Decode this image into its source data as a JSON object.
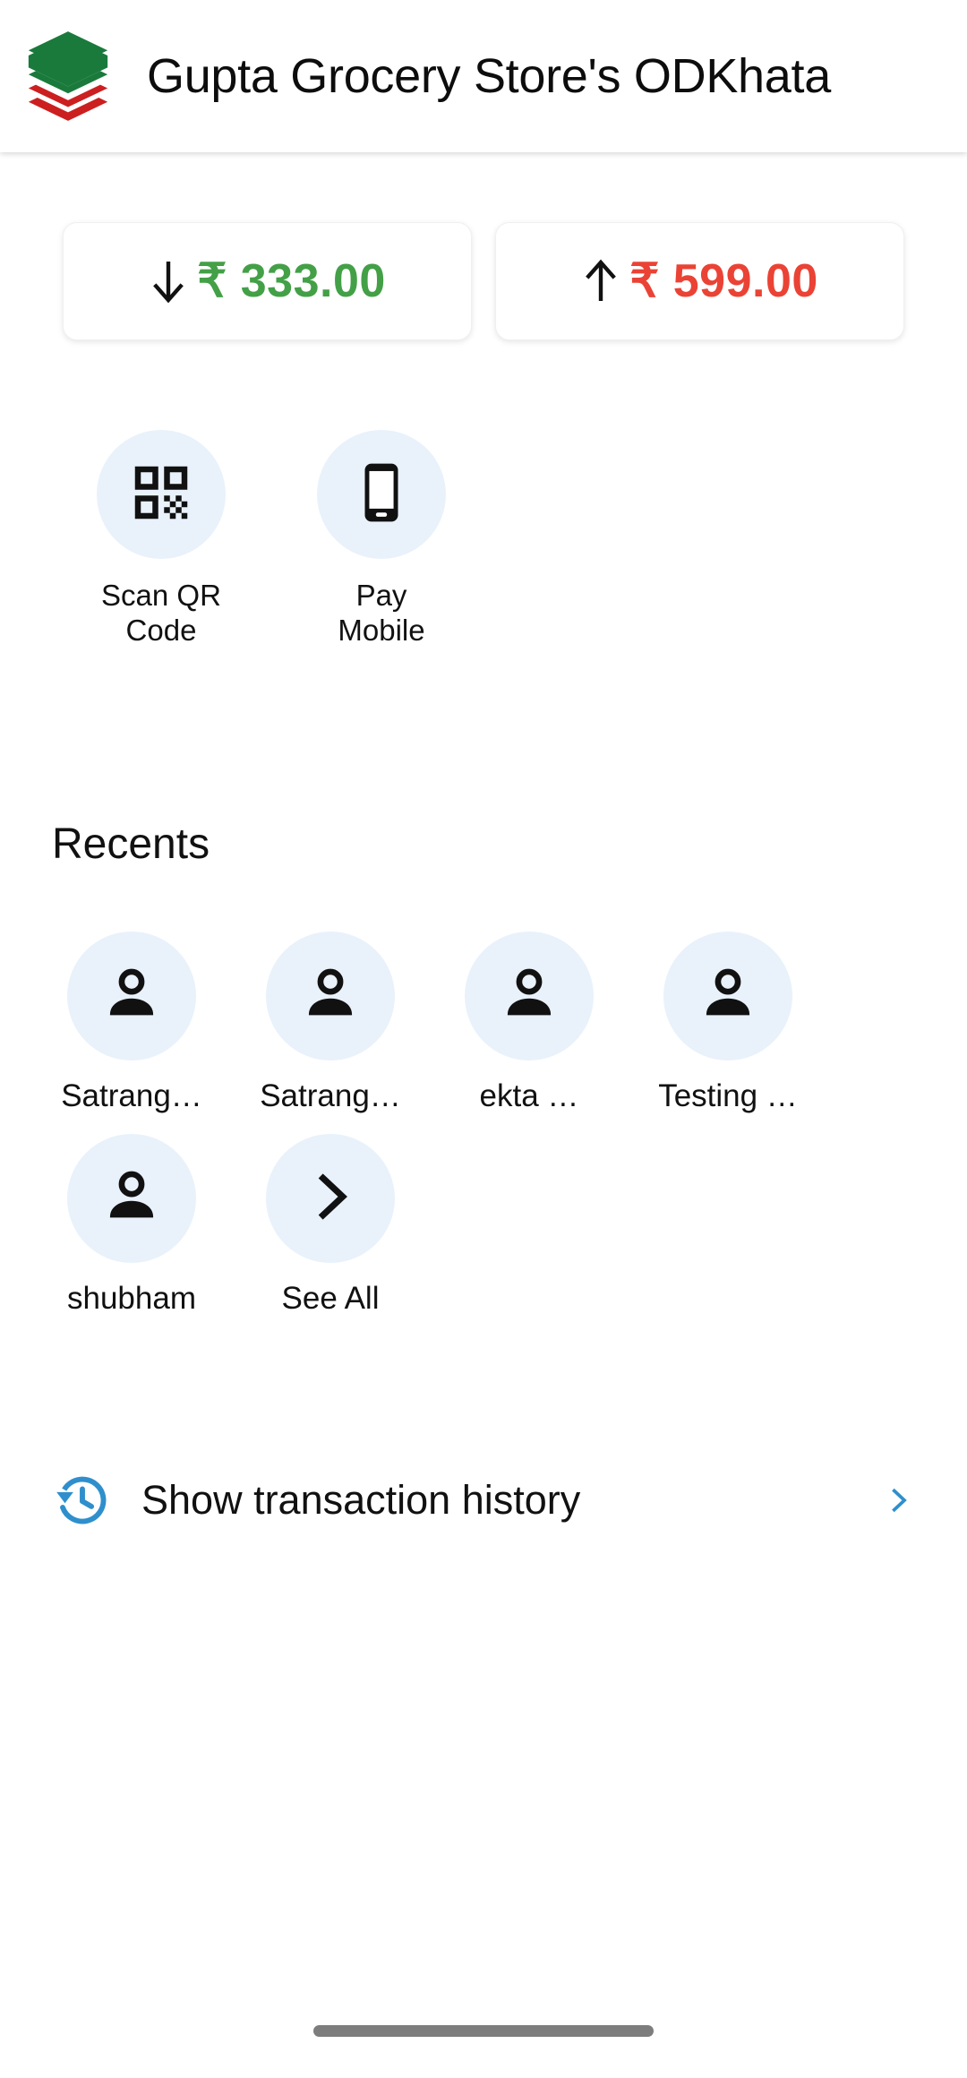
{
  "header": {
    "title": "Gupta Grocery Store's ODKhata",
    "logo_name": "odkhata-stacked-books-logo",
    "logo_colors": {
      "top": "#1a7a3c",
      "bottom": "#cc1f1f",
      "gap": "#ffffff"
    }
  },
  "balance": {
    "cards": [
      {
        "direction": "down",
        "arrow_icon": "arrow-down-icon",
        "currency": "₹",
        "amount": "333.00",
        "display": "₹ 333.00",
        "color": "#43a047"
      },
      {
        "direction": "up",
        "arrow_icon": "arrow-up-icon",
        "currency": "₹",
        "amount": "599.00",
        "display": "₹ 599.00",
        "color": "#ea4335"
      }
    ]
  },
  "quick_actions": [
    {
      "id": "scan-qr-code",
      "icon": "qr-code-icon",
      "line1": "Scan QR",
      "line2": "Code"
    },
    {
      "id": "pay-mobile",
      "icon": "smartphone-icon",
      "line1": "Pay",
      "line2": "Mobile"
    }
  ],
  "recents": {
    "title": "Recents",
    "contacts": [
      {
        "icon": "person-icon",
        "name": "Satrang…"
      },
      {
        "icon": "person-icon",
        "name": "Satrang…"
      },
      {
        "icon": "person-icon",
        "name": "ekta …"
      },
      {
        "icon": "person-icon",
        "name": "Testing …"
      },
      {
        "icon": "person-icon",
        "name": "shubham"
      },
      {
        "icon": "chevron-right-icon",
        "name": "See All"
      }
    ]
  },
  "transaction_history": {
    "icon": "history-clock-icon",
    "label": "Show transaction history",
    "chevron": "chevron-right-icon",
    "accent_color": "#2f8fcc"
  },
  "theme": {
    "icon_circle_bg": "#e9f2fb",
    "background": "#ffffff",
    "text": "#111111",
    "gesture_bar": "#7d7d7d"
  }
}
